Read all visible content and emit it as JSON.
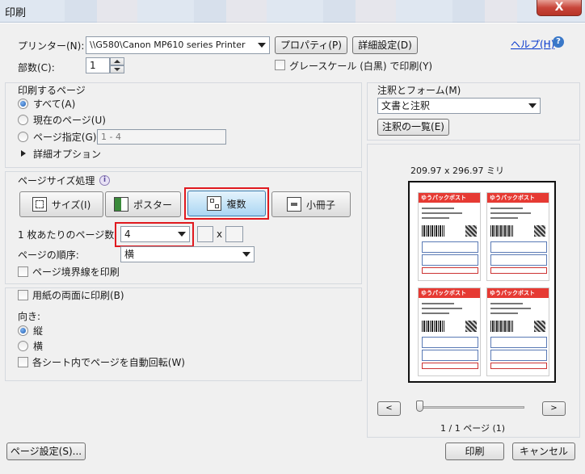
{
  "window": {
    "title": "印刷",
    "close_glyph": "X"
  },
  "printer": {
    "label": "プリンター(N):",
    "value": "\\\\G580\\Canon MP610 series Printer",
    "properties_button": "プロパティ(P)",
    "advanced_button": "詳細設定(D)",
    "help_link": "ヘルプ(H)",
    "copies_label": "部数(C):",
    "copies_value": "1",
    "grayscale_label": "グレースケール (白黒) で印刷(Y)"
  },
  "pages": {
    "title": "印刷するページ",
    "all": "すべて(A)",
    "current": "現在のページ(U)",
    "range": "ページ指定(G)",
    "range_placeholder": "1 - 4",
    "more_options": "詳細オプション"
  },
  "sizing": {
    "title": "ページサイズ処理",
    "info_glyph": "i",
    "size_button": "サイズ(I)",
    "poster_button": "ポスター",
    "multiple_button": "複数",
    "booklet_button": "小冊子",
    "pages_per_sheet_label": "1 枚あたりのページ数",
    "pages_per_sheet_value": "4",
    "x_label": "x",
    "order_label": "ページの順序:",
    "order_value": "横",
    "border_label": "ページ境界線を印刷"
  },
  "duplex": {
    "label": "用紙の両面に印刷(B)"
  },
  "orientation": {
    "title": "向き:",
    "portrait": "縦",
    "landscape": "横",
    "auto_rotate": "各シート内でページを自動回転(W)"
  },
  "comments": {
    "title": "注釈とフォーム(M)",
    "value": "文書と注釈",
    "summary_button": "注釈の一覧(E)"
  },
  "preview": {
    "size": "209.97 x 296.97 ミリ",
    "page_status": "1 / 1 ページ (1)",
    "prev": "<",
    "next": ">",
    "card_header": "ゆうパックポスト",
    "card_name": "ヂンパン 流木 様"
  },
  "footer": {
    "page_setup": "ページ設定(S)...",
    "print": "印刷",
    "cancel": "キャンセル"
  }
}
